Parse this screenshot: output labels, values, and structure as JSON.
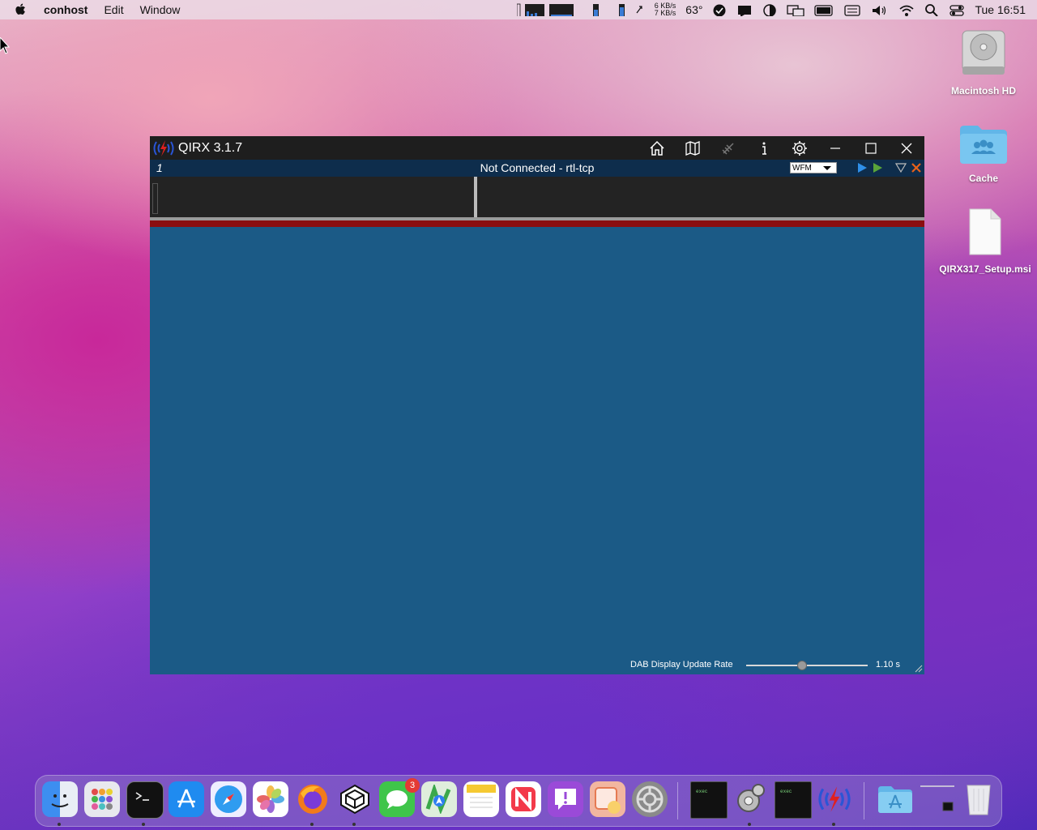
{
  "menubar": {
    "app_name": "conhost",
    "menus": [
      "Edit",
      "Window"
    ],
    "net_up": "6 KB/s",
    "net_down": "7 KB/s",
    "temperature": "63°",
    "clock": "Tue 16:51"
  },
  "desktop": {
    "icons": [
      {
        "label": "Macintosh HD",
        "icon": "hard-drive-icon"
      },
      {
        "label": "Cache",
        "icon": "shared-folder-icon"
      },
      {
        "label": "QIRX317_Setup.msi",
        "icon": "document-icon"
      }
    ]
  },
  "window": {
    "title": "QIRX 3.1.7",
    "status_index": "1",
    "connection_status": "Not Connected - rtl-tcp",
    "mode_selected": "WFM",
    "update_rate_label": "DAB Display Update Rate",
    "update_rate_value": "1.10 s",
    "update_rate_fraction": 0.46,
    "colors": {
      "titlebar": "#1e1e1e",
      "statusbar": "#0e2d4c",
      "main": "#1b5a86",
      "redbar": "#8b0e10"
    }
  },
  "dock": {
    "items": [
      "Finder",
      "Launchpad",
      "Terminal",
      "App Store",
      "Safari",
      "Photos",
      "Firefox",
      "Unity Hub",
      "Messages",
      "Maps",
      "Notes",
      "News",
      "Feedback Assistant",
      "Scrollbar",
      "System Preferences",
      "exec",
      "Wine config",
      "exec",
      "QIRX",
      "Applications",
      "Downloads",
      "Trash"
    ],
    "messages_badge": "3"
  }
}
